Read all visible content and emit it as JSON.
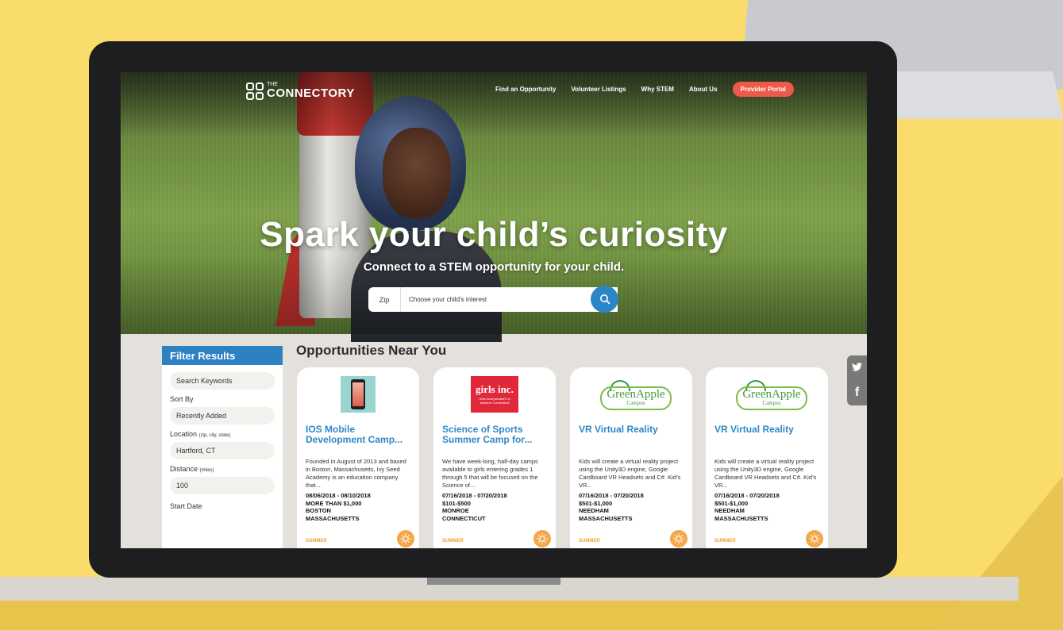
{
  "nav": {
    "logo_the": "THE",
    "logo_name": "CONNECTORY",
    "links": [
      "Find an Opportunity",
      "Volunteer Listings",
      "Why STEM",
      "About Us"
    ],
    "provider_button": "Provider Portal"
  },
  "hero": {
    "title": "Spark your child’s curiosity",
    "subtitle": "Connect to a STEM opportunity for your child.",
    "zip_label": "Zip",
    "interest_placeholder": "Choose your child’s interest"
  },
  "filters": {
    "heading": "Filter Results",
    "search_keywords": "Search Keywords",
    "sort_by_label": "Sort By",
    "sort_by_value": "Recently Added",
    "location_label": "Location",
    "location_hint": "(zip, city, state)",
    "location_value": "Hartford, CT",
    "distance_label": "Distance",
    "distance_hint": "(miles)",
    "distance_value": "100",
    "start_date_label": "Start Date"
  },
  "results": {
    "heading": "Opportunities Near You",
    "cards": [
      {
        "logo": "phone-app-logo",
        "title": "IOS Mobile Development Camp...",
        "desc": "Founded in August of 2013 and based in Boston, Massachusetts, Ivy Seed Academy is an education company that...",
        "dates": "08/06/2018 - 08/10/2018",
        "price": "MORE THAN $1,000",
        "city": "BOSTON",
        "state": "MASSACHUSETTS",
        "season": "SUMMER"
      },
      {
        "logo": "girls-inc-logo",
        "logo_text": "girls inc.",
        "logo_sub": "Girls Incorporated® of Western Connecticut",
        "title": "Science of Sports Summer Camp for...",
        "desc": "We have week-long, half-day camps available to girls entering grades 1 through 5 that will be focused on the Science of...",
        "dates": "07/16/2018 - 07/20/2018",
        "price": "$101-$500",
        "city": "MONROE",
        "state": "CONNECTICUT",
        "season": "SUMMER"
      },
      {
        "logo": "green-apple-logo",
        "logo_text": "GreenApple",
        "logo_sub": "Campus",
        "title": "VR Virtual Reality",
        "desc": "Kids will create a virtual reality project using the Unity3D engine, Google Cardboard VR Headsets and C#. Kid’s VR...",
        "dates": "07/16/2018 - 07/20/2018",
        "price": "$501-$1,000",
        "city": "NEEDHAM",
        "state": "MASSACHUSETTS",
        "season": "SUMMER"
      },
      {
        "logo": "green-apple-logo",
        "logo_text": "GreenApple",
        "logo_sub": "Campus",
        "title": "VR Virtual Reality",
        "desc": "Kids will create a virtual reality project using the Unity3D engine, Google Cardboard VR Headsets and C#. Kid’s VR...",
        "dates": "07/16/2018 - 07/20/2018",
        "price": "$501-$1,000",
        "city": "NEEDHAM",
        "state": "MASSACHUSETTS",
        "season": "SUMMER"
      }
    ]
  },
  "social": {
    "twitter": "twitter-icon",
    "facebook": "facebook-icon"
  },
  "colors": {
    "accent": "#2d80c2",
    "provider": "#ec5a4a",
    "summer": "#f0a030",
    "background": "#f9dc6c"
  }
}
